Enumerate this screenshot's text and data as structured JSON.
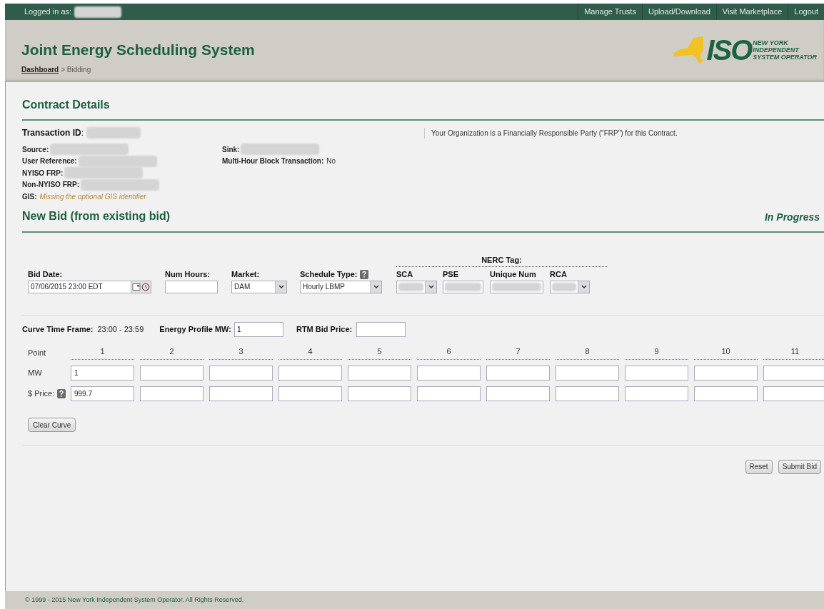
{
  "top_bar": {
    "logged_in_label": "Logged in as:",
    "links": [
      "Manage Trusts",
      "Upload/Download",
      "Visit Marketplace",
      "Logout"
    ]
  },
  "header": {
    "title": "Joint Energy Scheduling System",
    "breadcrumb": [
      {
        "label": "Dashboard",
        "kind": "link"
      },
      {
        "label": "> Bidding",
        "kind": "text"
      }
    ],
    "logo": {
      "mark": "ISO",
      "tagline": [
        "NEW YORK",
        "INDEPENDENT",
        "SYSTEM OPERATOR"
      ]
    }
  },
  "contract_details": {
    "heading": "Contract Details",
    "transaction_id": "**Transaction ID**:",
    "frp_notice": "Your Organization is a Financially Responsible Party (\"FRP\") for this Contract.",
    "left_fields": [
      {
        "label": "Source:",
        "kind": "redacted"
      },
      {
        "label": "User Reference:",
        "kind": "redacted"
      },
      {
        "label": "NYISO FRP:",
        "kind": "redacted"
      },
      {
        "label": "Non-NYISO FRP:",
        "kind": "redacted"
      },
      {
        "label": "GIS:",
        "kind": "note",
        "value": "Missing the optional GIS identifier"
      }
    ],
    "right_fields": [
      {
        "label": "Sink:",
        "kind": "redacted"
      },
      {
        "label": "Multi-Hour Block Transaction:",
        "kind": "value",
        "value": "No"
      }
    ]
  },
  "new_bid": {
    "heading": "New Bid (from existing bid)",
    "status": "In Progress",
    "fields": [
      {
        "label": "Bid Date:",
        "kind": "date",
        "value": "07/06/2015 23:00 EDT"
      },
      {
        "label": "Num Hours:",
        "kind": "text"
      },
      {
        "label": "Market:",
        "kind": "select",
        "value": "DAM"
      },
      {
        "label": "Schedule Type:",
        "kind": "select",
        "value": "Hourly LBMP",
        "help": true
      }
    ],
    "nerc_tag": {
      "label": "NERC Tag:",
      "fields": [
        {
          "label": "SCA",
          "kind": "select"
        },
        {
          "label": "PSE",
          "kind": "text"
        },
        {
          "label": "Unique Num",
          "kind": "text"
        },
        {
          "label": "RCA",
          "kind": "select"
        }
      ]
    }
  },
  "curve": {
    "time_frame_label": "Curve Time Frame:",
    "time_frame": "23:00 - 23:59",
    "energy_profile_label": "Energy Profile MW:",
    "energy_profile_value": "1",
    "rtm_label": "RTM Bid Price:",
    "point_label": "Point",
    "mw_label": "MW",
    "price_label": "$ Price:",
    "points": [
      {
        "label": "1",
        "mw": "1",
        "price": "999.7"
      },
      {
        "label": "2"
      },
      {
        "label": "3"
      },
      {
        "label": "4"
      },
      {
        "label": "5"
      },
      {
        "label": "6"
      },
      {
        "label": "7"
      },
      {
        "label": "8"
      },
      {
        "label": "9"
      },
      {
        "label": "10"
      },
      {
        "label": "11"
      }
    ],
    "clear_button": "Clear Curve"
  },
  "actions": [
    "Reset",
    "Submit Bid"
  ],
  "footer": "© 1999 - 2015 New York Independent System Operator. All Rights Reserved."
}
